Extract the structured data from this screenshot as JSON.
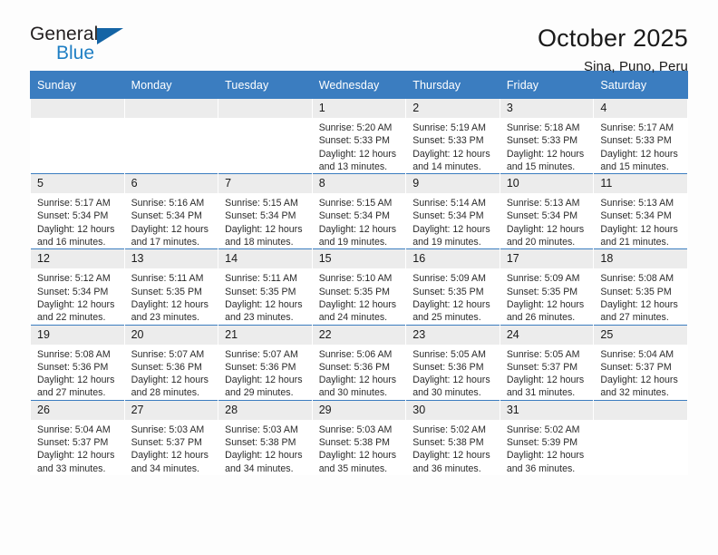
{
  "brand": {
    "name_top": "General",
    "name_bottom": "Blue",
    "accent": "#1f7fc4",
    "triangle": "#1464a5"
  },
  "header": {
    "title": "October 2025",
    "subtitle": "Sina, Puno, Peru"
  },
  "colors": {
    "header_row": "#3b7dc0",
    "daynum_band": "#ececec",
    "text": "#1a1a1a"
  },
  "labels": {
    "sunrise": "Sunrise:",
    "sunset": "Sunset:",
    "daylight": "Daylight:"
  },
  "weekdays": [
    "Sunday",
    "Monday",
    "Tuesday",
    "Wednesday",
    "Thursday",
    "Friday",
    "Saturday"
  ],
  "weeks": [
    [
      {
        "day": "",
        "empty": true
      },
      {
        "day": "",
        "empty": true
      },
      {
        "day": "",
        "empty": true
      },
      {
        "day": "1",
        "sunrise": "Sunrise: 5:20 AM",
        "sunset": "Sunset: 5:33 PM",
        "daylight1": "Daylight: 12 hours",
        "daylight2": "and 13 minutes."
      },
      {
        "day": "2",
        "sunrise": "Sunrise: 5:19 AM",
        "sunset": "Sunset: 5:33 PM",
        "daylight1": "Daylight: 12 hours",
        "daylight2": "and 14 minutes."
      },
      {
        "day": "3",
        "sunrise": "Sunrise: 5:18 AM",
        "sunset": "Sunset: 5:33 PM",
        "daylight1": "Daylight: 12 hours",
        "daylight2": "and 15 minutes."
      },
      {
        "day": "4",
        "sunrise": "Sunrise: 5:17 AM",
        "sunset": "Sunset: 5:33 PM",
        "daylight1": "Daylight: 12 hours",
        "daylight2": "and 15 minutes."
      }
    ],
    [
      {
        "day": "5",
        "sunrise": "Sunrise: 5:17 AM",
        "sunset": "Sunset: 5:34 PM",
        "daylight1": "Daylight: 12 hours",
        "daylight2": "and 16 minutes."
      },
      {
        "day": "6",
        "sunrise": "Sunrise: 5:16 AM",
        "sunset": "Sunset: 5:34 PM",
        "daylight1": "Daylight: 12 hours",
        "daylight2": "and 17 minutes."
      },
      {
        "day": "7",
        "sunrise": "Sunrise: 5:15 AM",
        "sunset": "Sunset: 5:34 PM",
        "daylight1": "Daylight: 12 hours",
        "daylight2": "and 18 minutes."
      },
      {
        "day": "8",
        "sunrise": "Sunrise: 5:15 AM",
        "sunset": "Sunset: 5:34 PM",
        "daylight1": "Daylight: 12 hours",
        "daylight2": "and 19 minutes."
      },
      {
        "day": "9",
        "sunrise": "Sunrise: 5:14 AM",
        "sunset": "Sunset: 5:34 PM",
        "daylight1": "Daylight: 12 hours",
        "daylight2": "and 19 minutes."
      },
      {
        "day": "10",
        "sunrise": "Sunrise: 5:13 AM",
        "sunset": "Sunset: 5:34 PM",
        "daylight1": "Daylight: 12 hours",
        "daylight2": "and 20 minutes."
      },
      {
        "day": "11",
        "sunrise": "Sunrise: 5:13 AM",
        "sunset": "Sunset: 5:34 PM",
        "daylight1": "Daylight: 12 hours",
        "daylight2": "and 21 minutes."
      }
    ],
    [
      {
        "day": "12",
        "sunrise": "Sunrise: 5:12 AM",
        "sunset": "Sunset: 5:34 PM",
        "daylight1": "Daylight: 12 hours",
        "daylight2": "and 22 minutes."
      },
      {
        "day": "13",
        "sunrise": "Sunrise: 5:11 AM",
        "sunset": "Sunset: 5:35 PM",
        "daylight1": "Daylight: 12 hours",
        "daylight2": "and 23 minutes."
      },
      {
        "day": "14",
        "sunrise": "Sunrise: 5:11 AM",
        "sunset": "Sunset: 5:35 PM",
        "daylight1": "Daylight: 12 hours",
        "daylight2": "and 23 minutes."
      },
      {
        "day": "15",
        "sunrise": "Sunrise: 5:10 AM",
        "sunset": "Sunset: 5:35 PM",
        "daylight1": "Daylight: 12 hours",
        "daylight2": "and 24 minutes."
      },
      {
        "day": "16",
        "sunrise": "Sunrise: 5:09 AM",
        "sunset": "Sunset: 5:35 PM",
        "daylight1": "Daylight: 12 hours",
        "daylight2": "and 25 minutes."
      },
      {
        "day": "17",
        "sunrise": "Sunrise: 5:09 AM",
        "sunset": "Sunset: 5:35 PM",
        "daylight1": "Daylight: 12 hours",
        "daylight2": "and 26 minutes."
      },
      {
        "day": "18",
        "sunrise": "Sunrise: 5:08 AM",
        "sunset": "Sunset: 5:35 PM",
        "daylight1": "Daylight: 12 hours",
        "daylight2": "and 27 minutes."
      }
    ],
    [
      {
        "day": "19",
        "sunrise": "Sunrise: 5:08 AM",
        "sunset": "Sunset: 5:36 PM",
        "daylight1": "Daylight: 12 hours",
        "daylight2": "and 27 minutes."
      },
      {
        "day": "20",
        "sunrise": "Sunrise: 5:07 AM",
        "sunset": "Sunset: 5:36 PM",
        "daylight1": "Daylight: 12 hours",
        "daylight2": "and 28 minutes."
      },
      {
        "day": "21",
        "sunrise": "Sunrise: 5:07 AM",
        "sunset": "Sunset: 5:36 PM",
        "daylight1": "Daylight: 12 hours",
        "daylight2": "and 29 minutes."
      },
      {
        "day": "22",
        "sunrise": "Sunrise: 5:06 AM",
        "sunset": "Sunset: 5:36 PM",
        "daylight1": "Daylight: 12 hours",
        "daylight2": "and 30 minutes."
      },
      {
        "day": "23",
        "sunrise": "Sunrise: 5:05 AM",
        "sunset": "Sunset: 5:36 PM",
        "daylight1": "Daylight: 12 hours",
        "daylight2": "and 30 minutes."
      },
      {
        "day": "24",
        "sunrise": "Sunrise: 5:05 AM",
        "sunset": "Sunset: 5:37 PM",
        "daylight1": "Daylight: 12 hours",
        "daylight2": "and 31 minutes."
      },
      {
        "day": "25",
        "sunrise": "Sunrise: 5:04 AM",
        "sunset": "Sunset: 5:37 PM",
        "daylight1": "Daylight: 12 hours",
        "daylight2": "and 32 minutes."
      }
    ],
    [
      {
        "day": "26",
        "sunrise": "Sunrise: 5:04 AM",
        "sunset": "Sunset: 5:37 PM",
        "daylight1": "Daylight: 12 hours",
        "daylight2": "and 33 minutes."
      },
      {
        "day": "27",
        "sunrise": "Sunrise: 5:03 AM",
        "sunset": "Sunset: 5:37 PM",
        "daylight1": "Daylight: 12 hours",
        "daylight2": "and 34 minutes."
      },
      {
        "day": "28",
        "sunrise": "Sunrise: 5:03 AM",
        "sunset": "Sunset: 5:38 PM",
        "daylight1": "Daylight: 12 hours",
        "daylight2": "and 34 minutes."
      },
      {
        "day": "29",
        "sunrise": "Sunrise: 5:03 AM",
        "sunset": "Sunset: 5:38 PM",
        "daylight1": "Daylight: 12 hours",
        "daylight2": "and 35 minutes."
      },
      {
        "day": "30",
        "sunrise": "Sunrise: 5:02 AM",
        "sunset": "Sunset: 5:38 PM",
        "daylight1": "Daylight: 12 hours",
        "daylight2": "and 36 minutes."
      },
      {
        "day": "31",
        "sunrise": "Sunrise: 5:02 AM",
        "sunset": "Sunset: 5:39 PM",
        "daylight1": "Daylight: 12 hours",
        "daylight2": "and 36 minutes."
      },
      {
        "day": "",
        "empty": true
      }
    ]
  ]
}
